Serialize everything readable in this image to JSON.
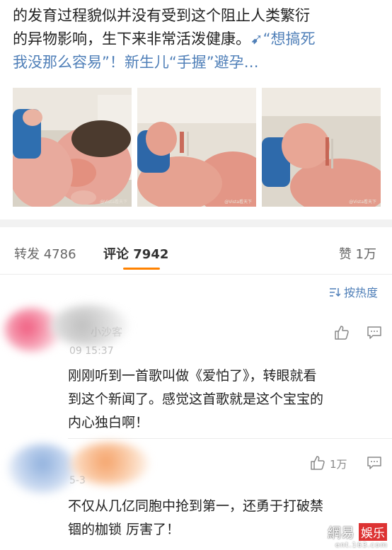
{
  "post": {
    "line1": "的发育过程貌似并没有受到这个阻止人类繁衍",
    "line2_text": "的异物影响，生下来非常活泼健康。",
    "line2_link": "➹“想搞死",
    "line3_link": "我没那么容易”！新生儿“手握”避孕…",
    "watermark": "@Vista看天下"
  },
  "tabs": {
    "repost_label": "转发",
    "repost_count": "4786",
    "comment_label": "评论",
    "comment_count": "7942",
    "like_label": "赞",
    "like_count": "1万"
  },
  "sort": {
    "label": "按热度"
  },
  "comments": [
    {
      "name": "小沙客",
      "time": "09 15:37",
      "text_line1": "刚刚听到一首歌叫做《爱怕了》，转眼就看",
      "text_line2": "到这个新闻了。感觉这首歌就是这个宝宝的",
      "text_line3": "内心独白啊！",
      "likes": ""
    },
    {
      "name": "",
      "time": "5-3",
      "text_line1": "不仅从几亿同胞中抢到第一，还勇于打破禁",
      "text_line2": "锢的枷锁 厉害了！",
      "likes": "1万"
    }
  ],
  "logo": {
    "brand_left": "網易",
    "brand_right": "娛乐",
    "url": "ent.163.com"
  },
  "colors": {
    "accent": "#ff8200",
    "link": "#4f7fb8"
  }
}
